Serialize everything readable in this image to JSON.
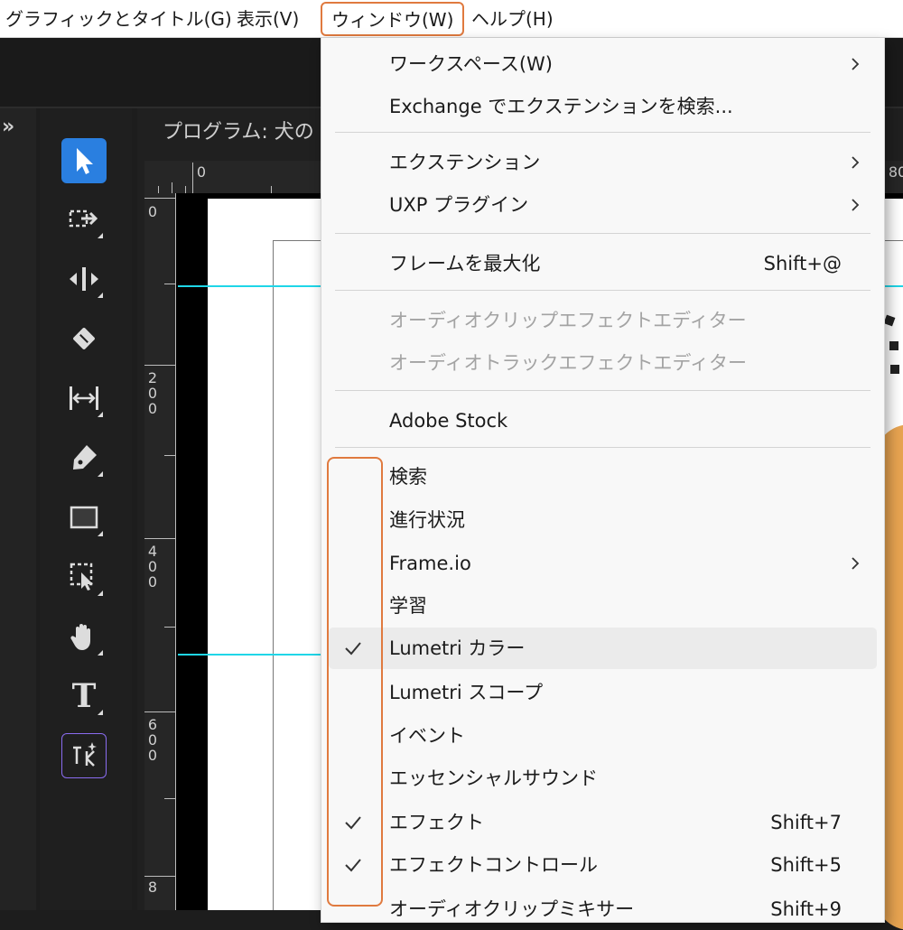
{
  "menubar": {
    "items": [
      {
        "label": "グラフィックとタイトル(G)"
      },
      {
        "label": "表示(V)"
      },
      {
        "label": "ウィンドウ(W)"
      },
      {
        "label": "ヘルプ(H)"
      }
    ],
    "highlight_color": "#e07a3f"
  },
  "program_monitor": {
    "title": "プログラム: 犬の",
    "ruler_top": [
      "0",
      "80"
    ],
    "ruler_left": [
      "0",
      "200",
      "400",
      "600",
      "8"
    ]
  },
  "tools": [
    {
      "icon": "selection-arrow-icon",
      "selected": true
    },
    {
      "icon": "track-select-forward-icon"
    },
    {
      "icon": "ripple-edit-icon"
    },
    {
      "icon": "razor-icon"
    },
    {
      "icon": "slip-tool-icon"
    },
    {
      "icon": "pen-tool-icon"
    },
    {
      "icon": "rectangle-tool-icon"
    },
    {
      "icon": "frame-select-icon"
    },
    {
      "icon": "hand-tool-icon"
    },
    {
      "icon": "type-tool-icon",
      "glyph": "T"
    },
    {
      "icon": "generative-extend-icon",
      "outlined": true
    }
  ],
  "window_menu": {
    "items": [
      {
        "label": "ワークスペース(W)",
        "submenu": true
      },
      {
        "label": "Exchange でエクステンションを検索..."
      },
      {
        "label": "エクステンション",
        "submenu": true
      },
      {
        "label": "UXP プラグイン",
        "submenu": true
      },
      {
        "label": "フレームを最大化",
        "shortcut": "Shift+@"
      },
      {
        "label": "オーディオクリップエフェクトエディター",
        "disabled": true
      },
      {
        "label": "オーディオトラックエフェクトエディター",
        "disabled": true
      },
      {
        "label": "Adobe Stock"
      },
      {
        "label": "検索"
      },
      {
        "label": "進行状況"
      },
      {
        "label": "Frame.io",
        "submenu": true
      },
      {
        "label": "学習"
      },
      {
        "label": "Lumetri カラー",
        "checked": true,
        "highlighted": true
      },
      {
        "label": "Lumetri スコープ"
      },
      {
        "label": "イベント"
      },
      {
        "label": "エッセンシャルサウンド"
      },
      {
        "label": "エフェクト",
        "checked": true,
        "shortcut": "Shift+7"
      },
      {
        "label": "エフェクトコントロール",
        "checked": true,
        "shortcut": "Shift+5"
      },
      {
        "label": "オーディオクリップミキサー",
        "shortcut": "Shift+9"
      }
    ]
  }
}
